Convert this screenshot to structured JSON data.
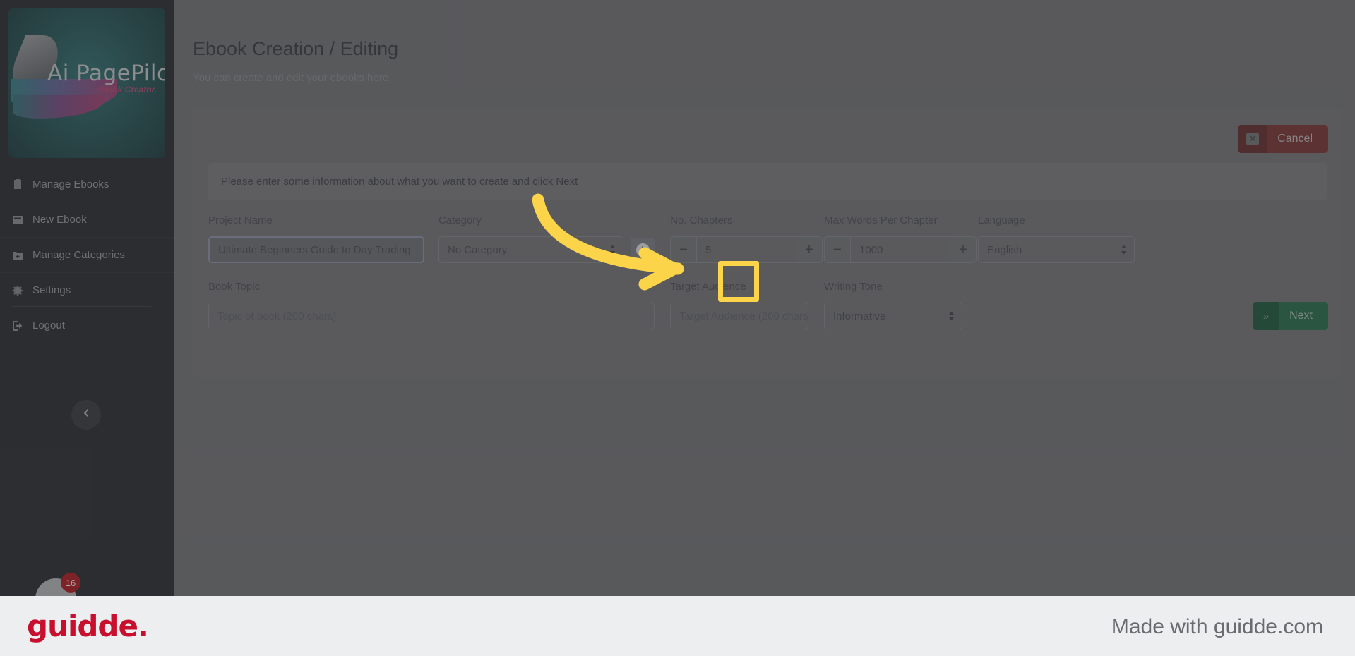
{
  "sidebar": {
    "logo": {
      "name": "Ai PagePilot",
      "tagline": "eBook Creator."
    },
    "items": [
      {
        "label": "Manage Ebooks",
        "icon": "clipboard-icon"
      },
      {
        "label": "New Ebook",
        "icon": "book-icon"
      },
      {
        "label": "Manage Categories",
        "icon": "folder-plus-icon"
      },
      {
        "label": "Settings",
        "icon": "gear-icon"
      },
      {
        "label": "Logout",
        "icon": "logout-icon"
      }
    ],
    "collapse_icon": "chevron-left-icon",
    "help_badge_count": "16"
  },
  "header": {
    "title": "Ebook Creation / Editing",
    "subtitle": "You can create and edit your ebooks here."
  },
  "card": {
    "cancel_label": "Cancel",
    "cancel_icon": "close-icon",
    "banner_text": "Please enter some information about what you want to create and click Next",
    "fields": {
      "project_name": {
        "label": "Project Name",
        "value": "Ultimate Beginners Guide to Day Trading"
      },
      "category": {
        "label": "Category",
        "value": "No Category",
        "add_button_icon": "plus-circle-icon"
      },
      "no_chapters": {
        "label": "No. Chapters",
        "value": "5",
        "minus": "−",
        "plus": "+"
      },
      "max_words": {
        "label": "Max Words Per Chapter",
        "value": "1000",
        "minus": "−",
        "plus": "+"
      },
      "language": {
        "label": "Language",
        "value": "English"
      },
      "book_topic": {
        "label": "Book Topic",
        "placeholder": "Topic of book (200 chars)"
      },
      "target_audience": {
        "label": "Target Audience",
        "placeholder": "Target Audience (200 chars)"
      },
      "writing_tone": {
        "label": "Writing Tone",
        "value": "Informative"
      }
    },
    "next_label": "Next",
    "next_icon": "double-chevron-right-icon"
  },
  "footer": {
    "brand": "guidde.",
    "made_with": "Made with guidde.com"
  },
  "colors": {
    "accent_highlight": "#fcd449",
    "brand_red": "#c8102e",
    "next_green": "#1d6a45",
    "cancel_red": "#762c2c"
  }
}
